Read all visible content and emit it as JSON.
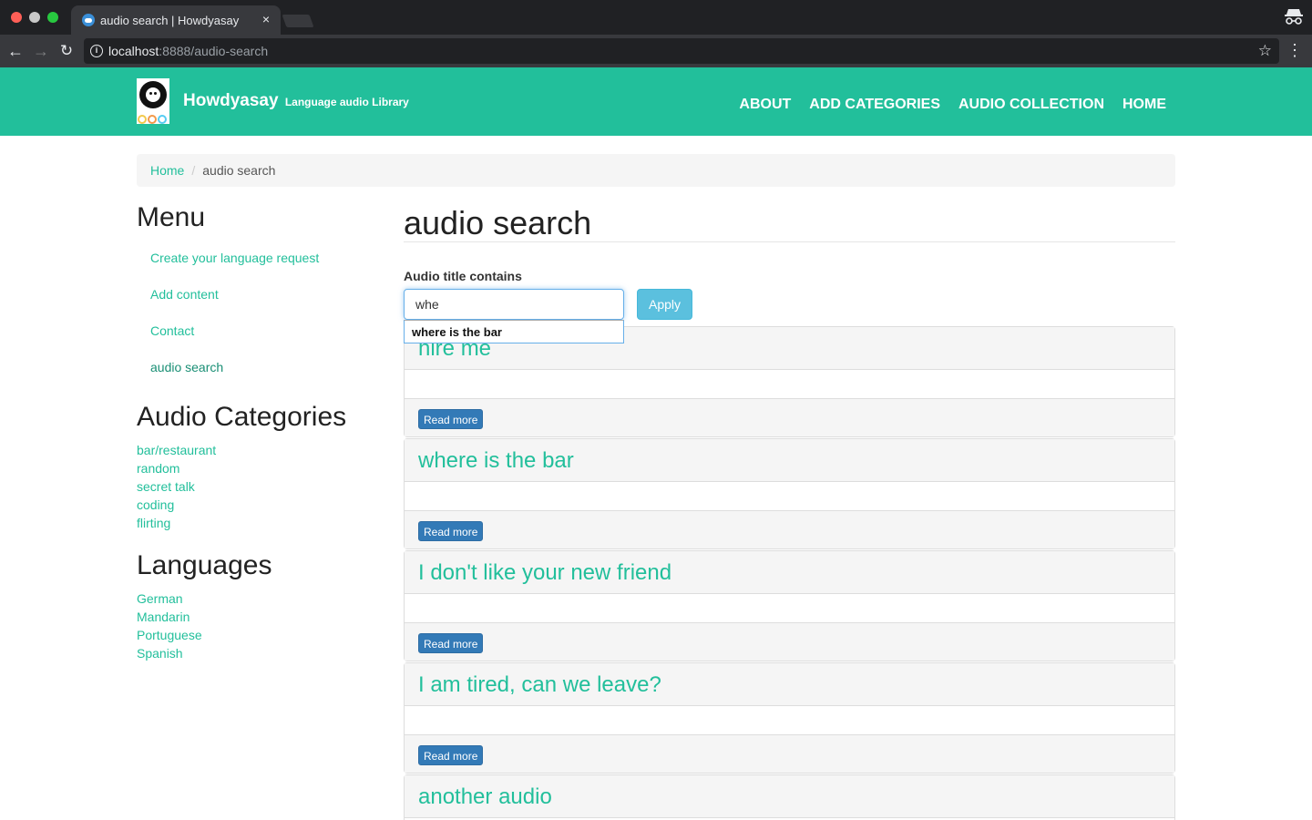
{
  "browser": {
    "tab_title": "audio search | Howdyasay",
    "tab_close": "×",
    "url_host": "localhost",
    "url_rest": ":8888/audio-search"
  },
  "site": {
    "name": "Howdyasay",
    "slogan": "Language audio Library",
    "brand_color": "#22bf9b",
    "nav": [
      "ABOUT",
      "ADD CATEGORIES",
      "AUDIO COLLECTION",
      "HOME"
    ]
  },
  "breadcrumb": {
    "home": "Home",
    "separator": "/",
    "current": "audio search"
  },
  "sidebar": {
    "menu_heading": "Menu",
    "menu_items": [
      "Create your language request",
      "Add content",
      "Contact",
      "audio search"
    ],
    "categories_heading": "Audio Categories",
    "categories": [
      "bar/restaurant",
      "random",
      "secret talk",
      "coding",
      "flirting"
    ],
    "languages_heading": "Languages",
    "languages": [
      "German",
      "Mandarin",
      "Portuguese",
      "Spanish"
    ]
  },
  "main": {
    "title": "audio search",
    "filter_label": "Audio title contains",
    "filter_value": "whe",
    "apply_label": "Apply",
    "autocomplete_suggestion": "where is the bar",
    "read_more_label": "Read more",
    "results": [
      "hire me",
      "where is the bar",
      "I don't like your new friend",
      "I am tired, can we leave?",
      "another audio"
    ]
  }
}
